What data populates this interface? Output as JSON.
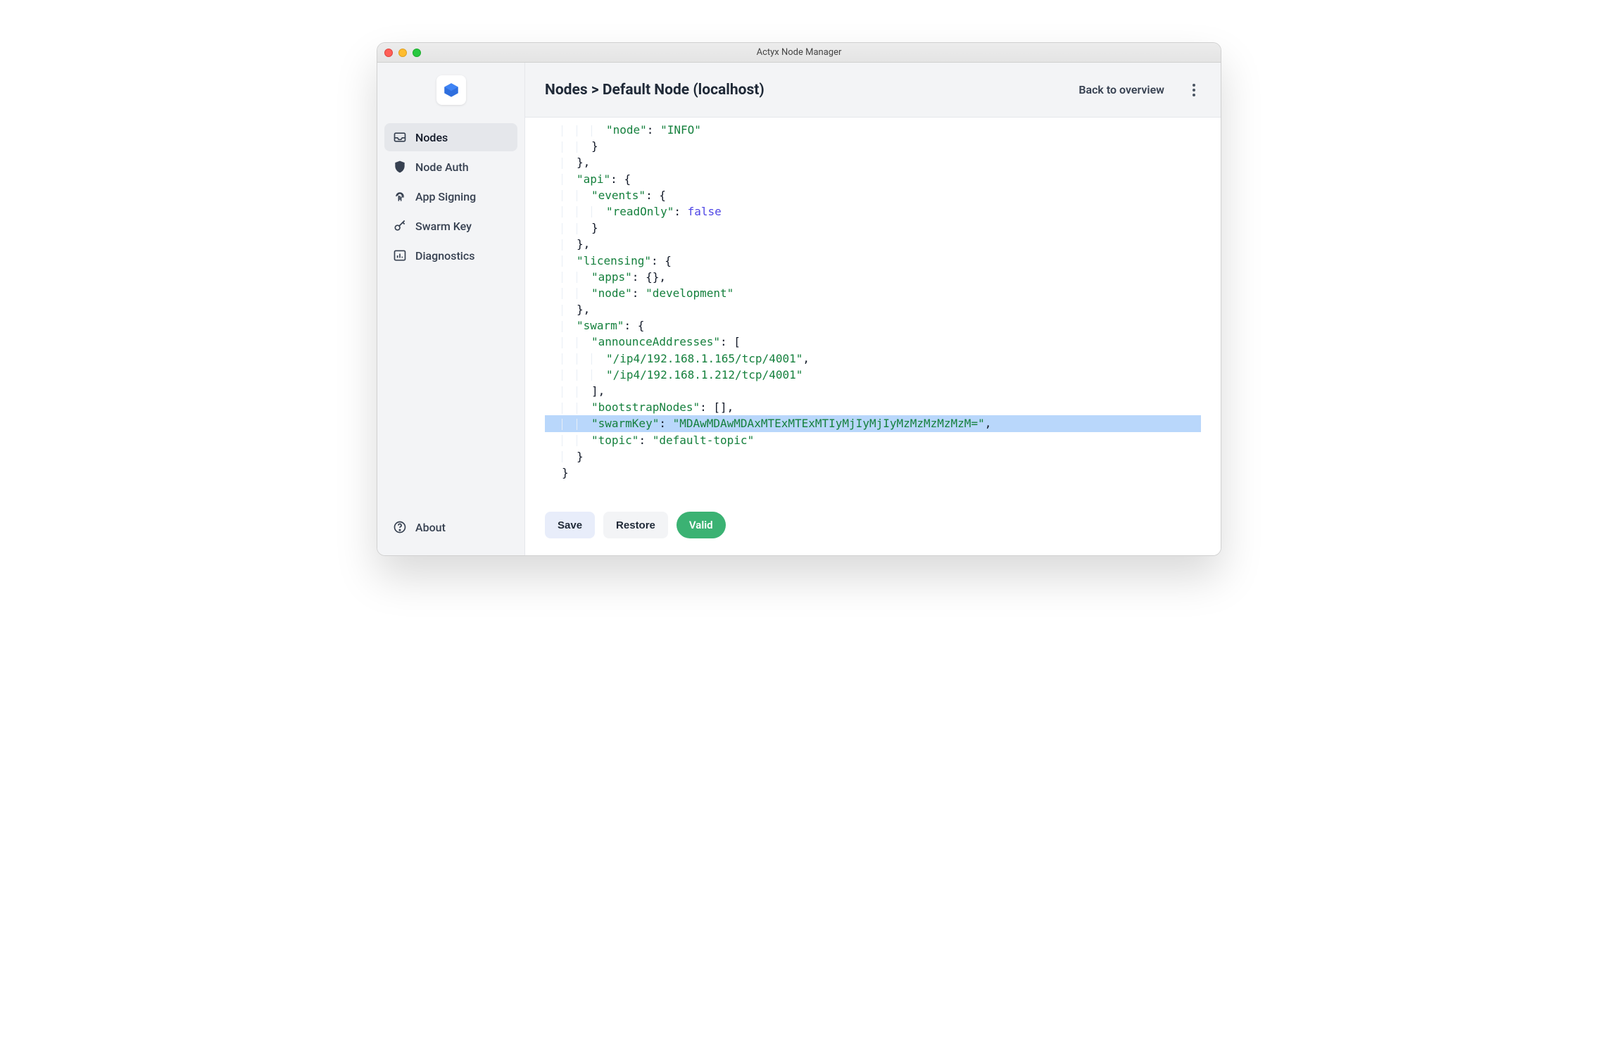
{
  "window": {
    "title": "Actyx Node Manager"
  },
  "sidebar": {
    "items": [
      {
        "label": "Nodes",
        "icon": "inbox-icon",
        "active": true
      },
      {
        "label": "Node Auth",
        "icon": "shield-icon",
        "active": false
      },
      {
        "label": "App Signing",
        "icon": "fingerprint-icon",
        "active": false
      },
      {
        "label": "Swarm Key",
        "icon": "key-icon",
        "active": false
      },
      {
        "label": "Diagnostics",
        "icon": "chart-icon",
        "active": false
      }
    ],
    "footer": {
      "label": "About",
      "icon": "help-icon"
    }
  },
  "header": {
    "breadcrumb": "Nodes > Default Node (localhost)",
    "back_label": "Back to overview"
  },
  "buttons": {
    "save": "Save",
    "restore": "Restore",
    "valid": "Valid"
  },
  "editor_json": {
    "admin": {
      "node": "INFO"
    },
    "api": {
      "events": {
        "readOnly": false
      }
    },
    "licensing": {
      "apps": {},
      "node": "development"
    },
    "swarm": {
      "announceAddresses": [
        "/ip4/192.168.1.165/tcp/4001",
        "/ip4/192.168.1.212/tcp/4001"
      ],
      "bootstrapNodes": [],
      "swarmKey": "MDAwMDAwMDAxMTExMTExMTIyMjIyMjIyMzMzMzMzMzM=",
      "topic": "default-topic"
    }
  },
  "editor_lines": [
    {
      "indent": 3,
      "html": "<span class='k'>\"node\"</span>: <span class='v-str'>\"INFO\"</span>"
    },
    {
      "indent": 2,
      "html": "}"
    },
    {
      "indent": 1,
      "html": "},"
    },
    {
      "indent": 1,
      "html": "<span class='k'>\"api\"</span>: {"
    },
    {
      "indent": 2,
      "html": "<span class='k'>\"events\"</span>: {"
    },
    {
      "indent": 3,
      "html": "<span class='k'>\"readOnly\"</span>: <span class='v-bool'>false</span>"
    },
    {
      "indent": 2,
      "html": "}"
    },
    {
      "indent": 1,
      "html": "},"
    },
    {
      "indent": 1,
      "html": "<span class='k'>\"licensing\"</span>: {"
    },
    {
      "indent": 2,
      "html": "<span class='k'>\"apps\"</span>: {},"
    },
    {
      "indent": 2,
      "html": "<span class='k'>\"node\"</span>: <span class='v-str'>\"development\"</span>"
    },
    {
      "indent": 1,
      "html": "},"
    },
    {
      "indent": 1,
      "html": "<span class='k'>\"swarm\"</span>: {"
    },
    {
      "indent": 2,
      "html": "<span class='k'>\"announceAddresses\"</span>: ["
    },
    {
      "indent": 3,
      "html": "<span class='v-str'>\"/ip4/192.168.1.165/tcp/4001\"</span>,"
    },
    {
      "indent": 3,
      "html": "<span class='v-str'>\"/ip4/192.168.1.212/tcp/4001\"</span>"
    },
    {
      "indent": 2,
      "html": "],"
    },
    {
      "indent": 2,
      "html": "<span class='k'>\"bootstrapNodes\"</span>: [],"
    },
    {
      "indent": 2,
      "html": "<span class='k'>\"swarmKey\"</span>: <span class='v-str'>\"MDAwMDAwMDAxMTExMTExMTIyMjIyMjIyMzMzMzMzMzM=\"</span>,",
      "highlight": true
    },
    {
      "indent": 2,
      "html": "<span class='k'>\"topic\"</span>: <span class='v-str'>\"default-topic\"</span>"
    },
    {
      "indent": 1,
      "html": "}"
    },
    {
      "indent": 0,
      "html": "}"
    }
  ]
}
